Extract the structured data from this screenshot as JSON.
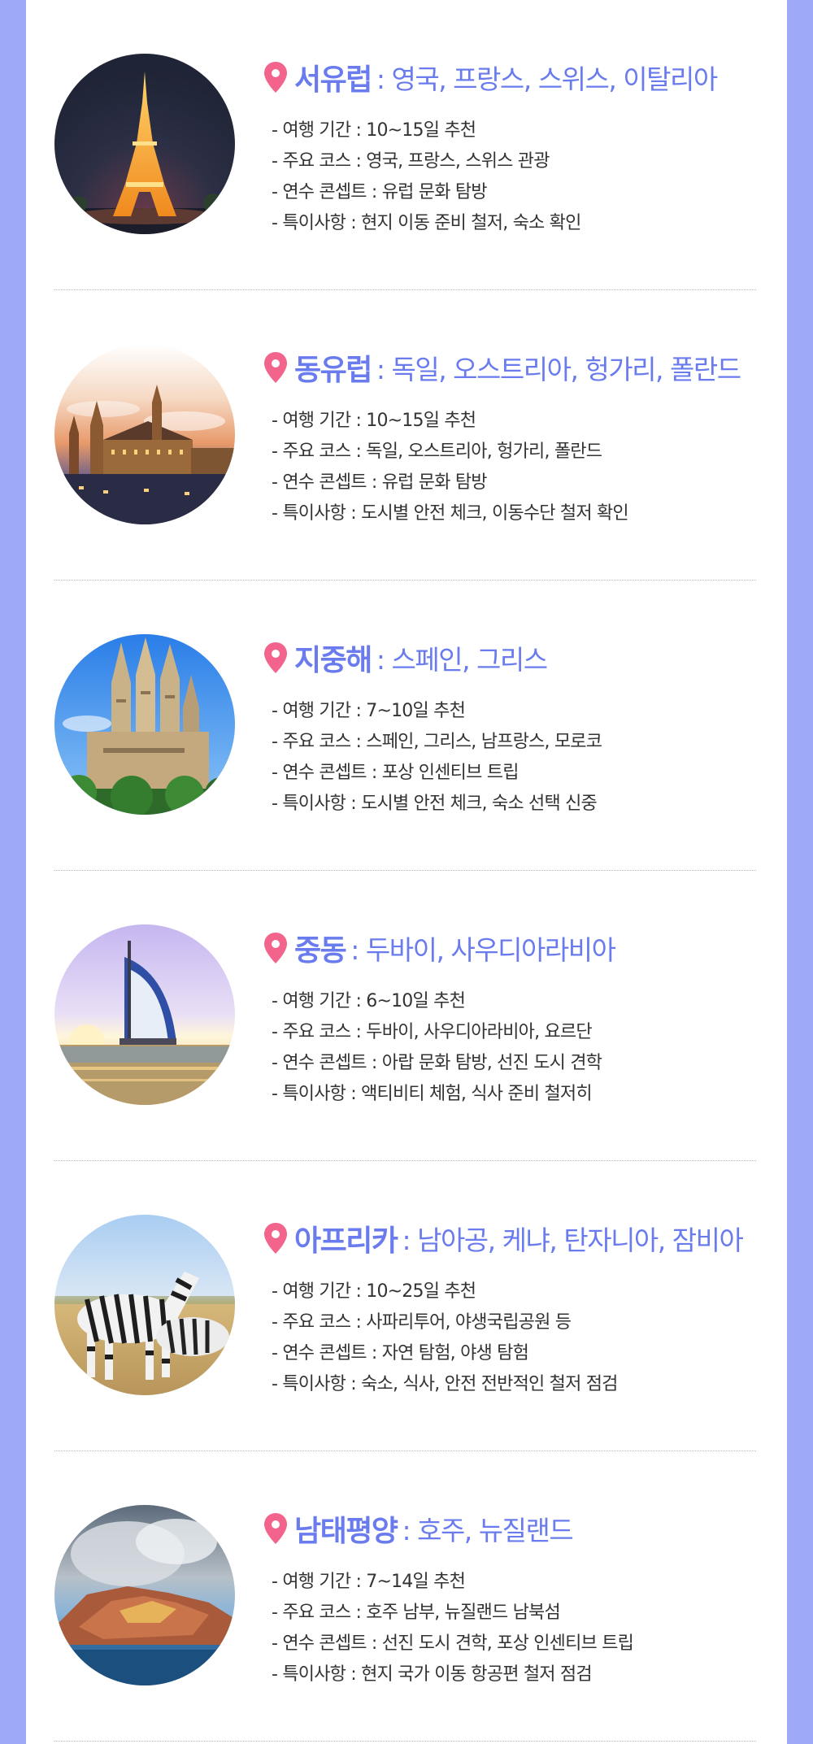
{
  "regions": [
    {
      "name": "서유럽",
      "countries": ": 영국, 프랑스, 스위스, 이탈리아",
      "details": [
        "- 여행 기간 : 10~15일 추천",
        "- 주요 코스 : 영국, 프랑스, 스위스 관광",
        "- 연수 콘셉트 : 유럽 문화 탐방",
        "- 특이사항 : 현지 이동 준비 철저, 숙소 확인"
      ],
      "photo": "eiffel-tower-night"
    },
    {
      "name": "동유럽",
      "countries": ": 독일, 오스트리아, 헝가리, 폴란드",
      "details": [
        "- 여행 기간 : 10~15일 추천",
        "- 주요 코스 : 독일, 오스트리아, 헝가리, 폴란드",
        "- 연수 콘셉트 : 유럽 문화 탐방",
        "- 특이사항 : 도시별 안전 체크, 이동수단 철저 확인"
      ],
      "photo": "prague-castle-sunset"
    },
    {
      "name": "지중해",
      "countries": ": 스페인, 그리스",
      "details": [
        "- 여행 기간 : 7~10일 추천",
        "- 주요 코스 : 스페인, 그리스, 남프랑스, 모로코",
        "- 연수 콘셉트 : 포상 인센티브 트립",
        "- 특이사항 : 도시별 안전 체크, 숙소 선택 신중"
      ],
      "photo": "sagrada-familia"
    },
    {
      "name": "중동",
      "countries": ": 두바이, 사우디아라비아",
      "details": [
        "- 여행 기간 : 6~10일 추천",
        "- 주요 코스 : 두바이, 사우디아라비아, 요르단",
        "- 연수 콘셉트 : 아랍 문화 탐방, 선진 도시 견학",
        "- 특이사항 : 액티비티 체험, 식사 준비 철저히"
      ],
      "photo": "burj-al-arab"
    },
    {
      "name": "아프리카",
      "countries": ": 남아공, 케냐, 탄자니아, 잠비아",
      "details": [
        "- 여행 기간 : 10~25일 추천",
        "- 주요 코스 : 사파리투어, 야생국립공원 등",
        "- 연수 콘셉트 : 자연 탐험, 야생 탐험",
        "- 특이사항 : 숙소, 식사, 안전 전반적인 철저 점검"
      ],
      "photo": "zebras-savanna"
    },
    {
      "name": "남태평양",
      "countries": ": 호주, 뉴질랜드",
      "details": [
        "- 여행 기간 : 7~14일 추천",
        "- 주요 코스 : 호주 남부, 뉴질랜드 남북섬",
        "- 연수 콘셉트 : 선진 도시 견학, 포상 인센티브 트립",
        "- 특이사항 : 현지 국가 이동 항공편 철저 점검"
      ],
      "photo": "volcanic-island"
    }
  ],
  "colors": {
    "accent": "#6a7ced",
    "pin": "#f2648b",
    "side": "#9eaaf6",
    "text": "#333333"
  }
}
